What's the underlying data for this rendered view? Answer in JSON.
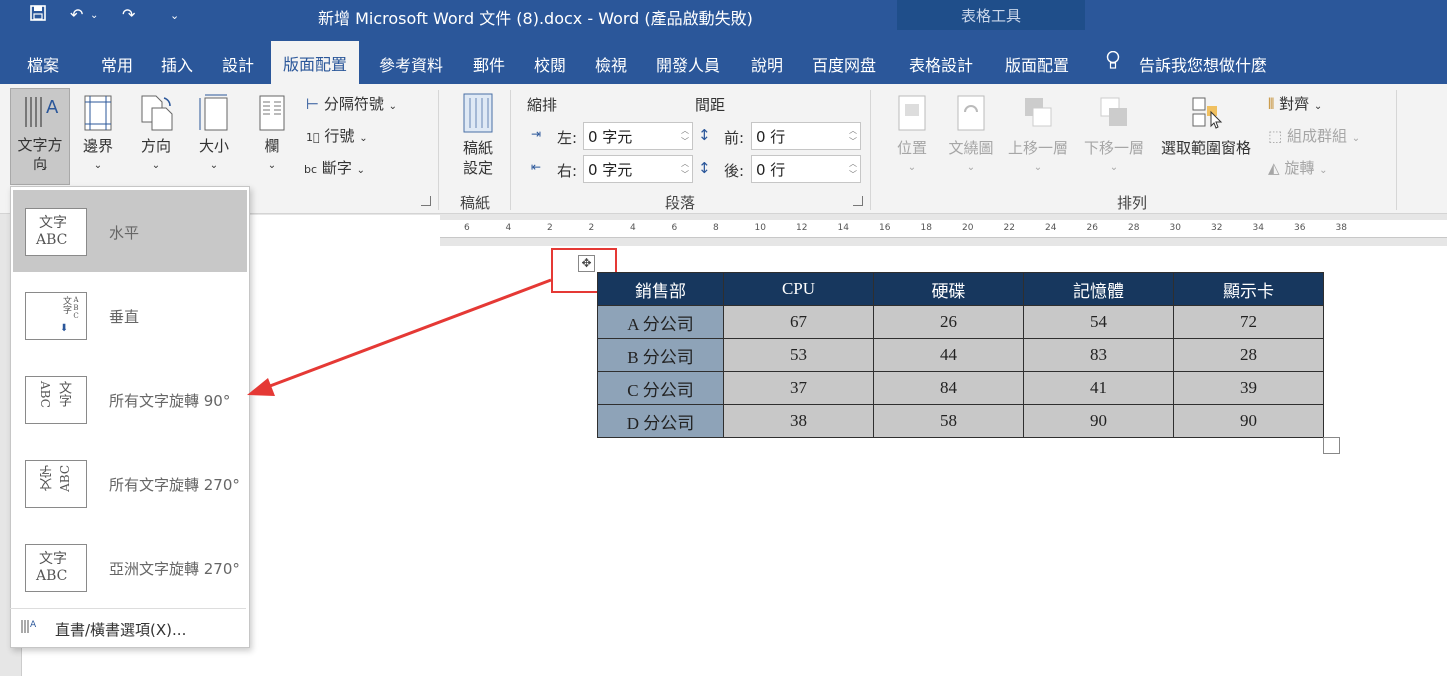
{
  "window": {
    "title": "新增 Microsoft Word 文件 (8).docx  -  Word (產品啟動失敗)",
    "table_tools": "表格工具"
  },
  "tabs": [
    "檔案",
    "常用",
    "插入",
    "設計",
    "版面配置",
    "參考資料",
    "郵件",
    "校閱",
    "檢視",
    "開發人員",
    "說明",
    "百度网盘",
    "表格設計",
    "版面配置"
  ],
  "tell_me": "告訴我您想做什麼",
  "ribbon": {
    "text_direction": [
      "文字方",
      "向"
    ],
    "margins": "邊界",
    "orientation": "方向",
    "size": "大小",
    "columns": "欄",
    "breaks": "分隔符號",
    "line_numbers": "行號",
    "hyphenation": "斷字",
    "draft_settings": [
      "稿紙",
      "設定"
    ],
    "draft_group": "稿紙",
    "indent_title": "縮排",
    "spacing_title": "間距",
    "indent_left_label": "左:",
    "indent_left_value": "0 字元",
    "indent_right_label": "右:",
    "indent_right_value": "0 字元",
    "spacing_before_label": "前:",
    "spacing_before_value": "0 行",
    "spacing_after_label": "後:",
    "spacing_after_value": "0 行",
    "paragraph_group": "段落",
    "position": "位置",
    "wrap_text": "文繞圖",
    "bring_forward": "上移一層",
    "send_backward": "下移一層",
    "selection_pane": "選取範圍窗格",
    "align": "對齊",
    "group": "組成群組",
    "rotate": "旋轉",
    "arrange_group": "排列"
  },
  "ruler_numbers": [
    "6",
    "4",
    "2",
    "2",
    "4",
    "6",
    "8",
    "10",
    "12",
    "14",
    "16",
    "18",
    "20",
    "22",
    "24",
    "26",
    "28",
    "30",
    "32",
    "34",
    "36",
    "38"
  ],
  "dropdown": {
    "options": [
      {
        "label": "水平",
        "selected": true
      },
      {
        "label": "垂直",
        "selected": false
      },
      {
        "label": "所有文字旋轉 90°",
        "selected": false
      },
      {
        "label": "所有文字旋轉 270°",
        "selected": false
      },
      {
        "label": "亞洲文字旋轉 270°",
        "selected": false
      }
    ],
    "icon_text_asian": "文字",
    "icon_text_latin": "ABC",
    "footer": "直書/橫書選項(X)..."
  },
  "table": {
    "headers": [
      "銷售部",
      "CPU",
      "硬碟",
      "記憶體",
      "顯示卡"
    ],
    "rows": [
      [
        "A 分公司",
        "67",
        "26",
        "54",
        "72"
      ],
      [
        "B 分公司",
        "53",
        "44",
        "83",
        "28"
      ],
      [
        "C 分公司",
        "37",
        "84",
        "41",
        "39"
      ],
      [
        "D 分公司",
        "38",
        "58",
        "90",
        "90"
      ]
    ]
  },
  "colors": {
    "ribbon_blue": "#2b579a",
    "table_header": "#17375e",
    "row_header": "#8ea3b8",
    "cell_bg": "#c8c8c8",
    "annotation_red": "#e53935"
  }
}
